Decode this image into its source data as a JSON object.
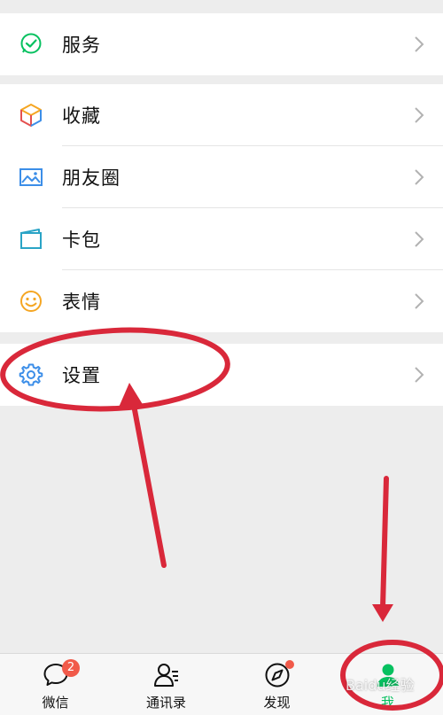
{
  "menu_groups": [
    {
      "items": [
        {
          "label": "服务",
          "icon": "service-icon"
        }
      ]
    },
    {
      "items": [
        {
          "label": "收藏",
          "icon": "favorites-icon"
        },
        {
          "label": "朋友圈",
          "icon": "moments-icon"
        },
        {
          "label": "卡包",
          "icon": "cards-icon"
        },
        {
          "label": "表情",
          "icon": "stickers-icon"
        }
      ]
    },
    {
      "items": [
        {
          "label": "设置",
          "icon": "settings-icon"
        }
      ]
    }
  ],
  "tabbar": {
    "tabs": [
      {
        "label": "微信",
        "icon": "chat-icon",
        "badge": "2"
      },
      {
        "label": "通讯录",
        "icon": "contacts-icon"
      },
      {
        "label": "发现",
        "icon": "discover-icon",
        "has_dot": true
      },
      {
        "label": "我",
        "icon": "me-icon",
        "active": true
      }
    ]
  },
  "colors": {
    "accent_green": "#07c160",
    "badge_red": "#f15a4a",
    "annotation_red": "#d9283a"
  },
  "watermark": "Baidu经验"
}
